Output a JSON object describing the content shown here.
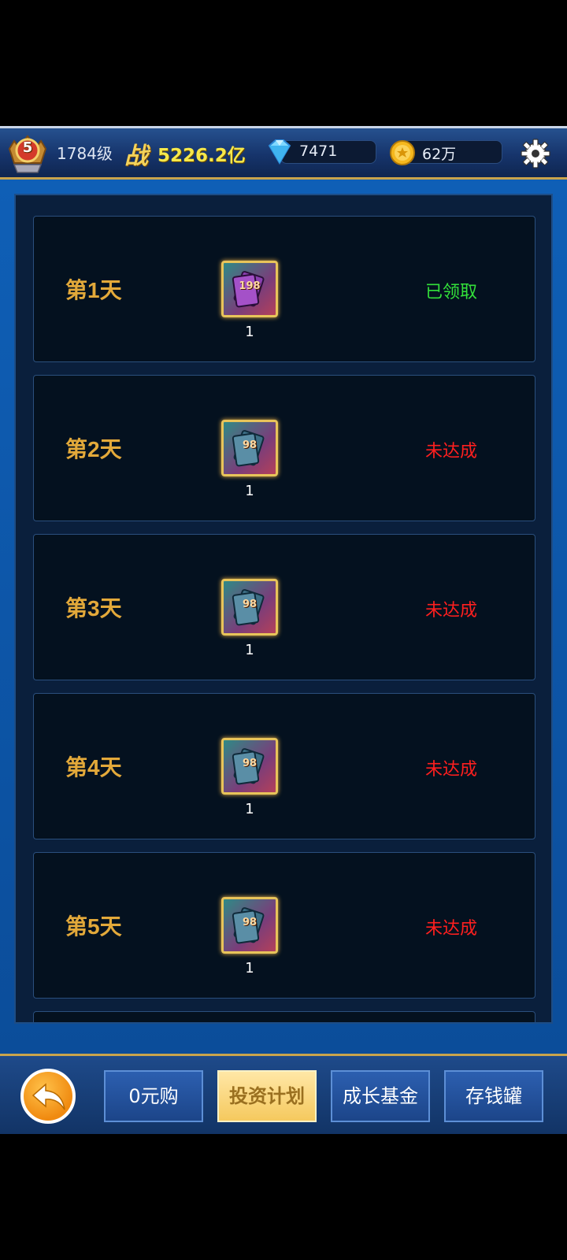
{
  "header": {
    "vip_level": "5",
    "player_level": "1784级",
    "power_label": "战",
    "power_value": "5226.2亿",
    "diamonds": "7471",
    "gold": "62万"
  },
  "rows": [
    {
      "day": "第1天",
      "item_label": "198",
      "quantity": "1",
      "status": "已领取",
      "status_color": "#33e03a"
    },
    {
      "day": "第2天",
      "item_label": "98",
      "quantity": "1",
      "status": "未达成",
      "status_color": "#ff1f1f"
    },
    {
      "day": "第3天",
      "item_label": "98",
      "quantity": "1",
      "status": "未达成",
      "status_color": "#ff1f1f"
    },
    {
      "day": "第4天",
      "item_label": "98",
      "quantity": "1",
      "status": "未达成",
      "status_color": "#ff1f1f"
    },
    {
      "day": "第5天",
      "item_label": "98",
      "quantity": "1",
      "status": "未达成",
      "status_color": "#ff1f1f"
    }
  ],
  "tabs": [
    {
      "label": "0元购",
      "active": false
    },
    {
      "label": "投资计划",
      "active": true
    },
    {
      "label": "成长基金",
      "active": false
    },
    {
      "label": "存钱罐",
      "active": false
    }
  ]
}
